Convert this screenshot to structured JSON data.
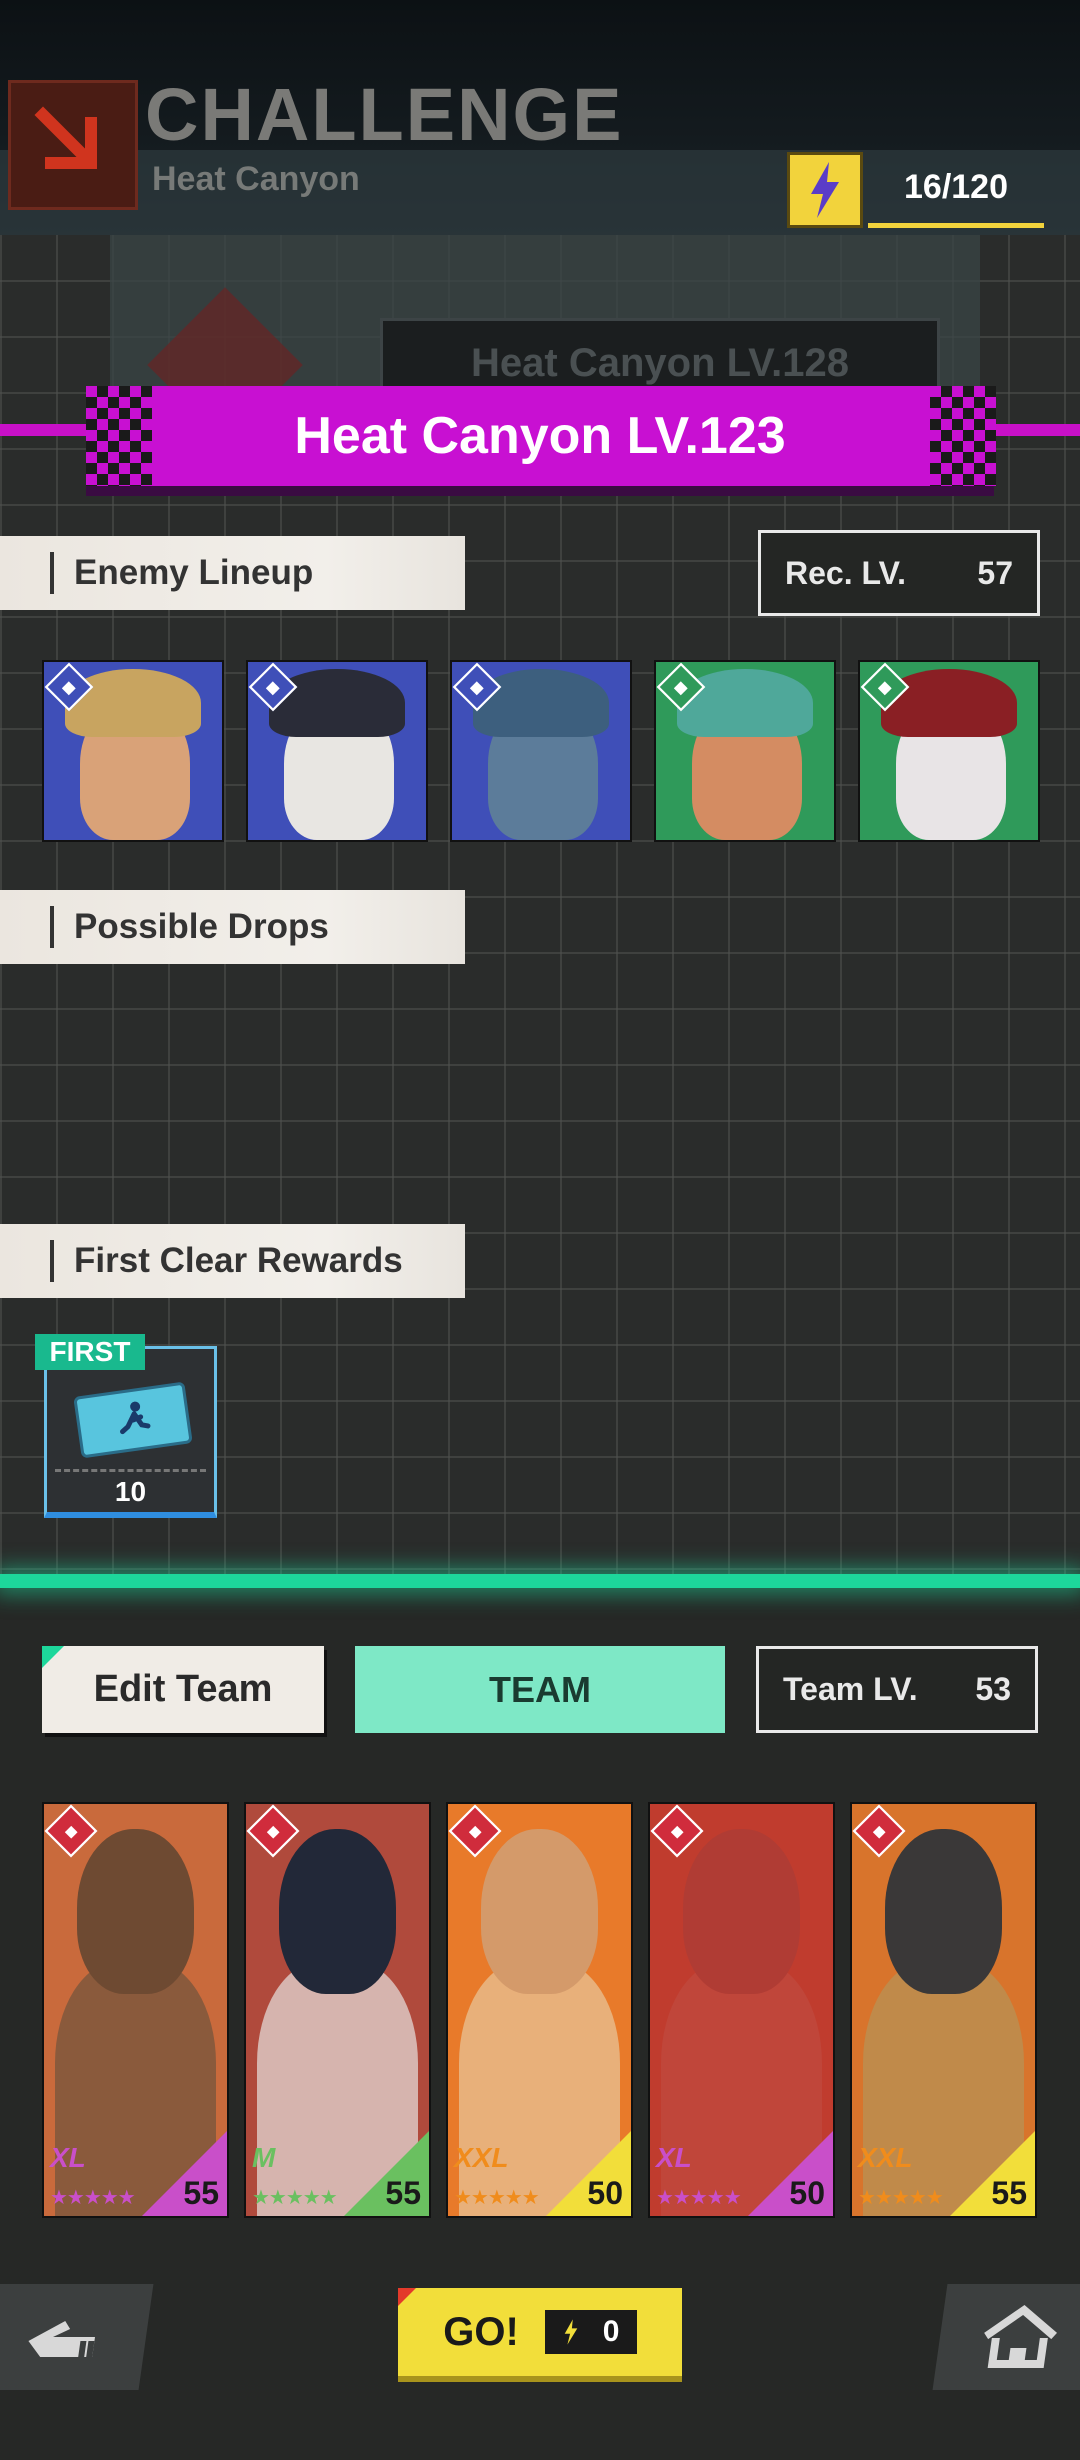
{
  "header": {
    "title": "CHALLENGE",
    "subtitle": "Heat Canyon",
    "stamina": "16/120"
  },
  "locked_level": "Heat Canyon LV.128",
  "level_banner": "Heat Canyon LV.123",
  "enemy_section": {
    "label": "Enemy Lineup",
    "rec_label": "Rec. LV.",
    "rec_value": "57"
  },
  "enemies": [
    {
      "class_icon": "plus-class-icon",
      "colors": {
        "bg": "#3f4fb8",
        "hair": "#c8a460",
        "face": "#d9a278"
      }
    },
    {
      "class_icon": "shield-class-icon",
      "colors": {
        "bg": "#3f4fb8",
        "hair": "#2a2c38",
        "face": "#e8e6e2"
      }
    },
    {
      "class_icon": "eye-class-icon",
      "colors": {
        "bg": "#3f4fb8",
        "hair": "#3d5f7e",
        "face": "#5c7c9a"
      }
    },
    {
      "class_icon": "eye-class-icon",
      "colors": {
        "bg": "#2f9a5a",
        "hair": "#4fa89a",
        "face": "#d48c62"
      }
    },
    {
      "class_icon": "shield-class-icon",
      "colors": {
        "bg": "#2f9a5a",
        "hair": "#8a1f24",
        "face": "#e8e4e6"
      }
    }
  ],
  "drops_section": {
    "label": "Possible Drops"
  },
  "rewards_section": {
    "label": "First Clear Rewards",
    "first_tag": "FIRST",
    "reward_qty": "10",
    "ticket_icon": "runner-ticket-icon"
  },
  "team": {
    "edit_label": "Edit Team",
    "team_label": "TEAM",
    "level_label": "Team LV.",
    "level_value": "53"
  },
  "members": [
    {
      "rank": "XL",
      "level": "55",
      "stars": "★★★★★",
      "colors": {
        "bg": "#c96a3c",
        "skin": "#8a5a3c",
        "head": "#6e4a32",
        "corner": "#c94fc9",
        "rank": "#c94fc9",
        "cls": "#d02c3c"
      }
    },
    {
      "rank": "M",
      "level": "55",
      "stars": "★★★★★",
      "colors": {
        "bg": "#b04a3c",
        "skin": "#d6b4ae",
        "head": "#222838",
        "corner": "#6ac060",
        "rank": "#6ac060",
        "cls": "#d02c3c"
      }
    },
    {
      "rank": "XXL",
      "level": "50",
      "stars": "★★★★★",
      "colors": {
        "bg": "#e87a2a",
        "skin": "#e8b07a",
        "head": "#d49a6a",
        "corner": "#f2de3a",
        "rank": "#f08c1c",
        "cls": "#d02c3c"
      }
    },
    {
      "rank": "XL",
      "level": "50",
      "stars": "★★★★★",
      "colors": {
        "bg": "#c03c2e",
        "skin": "#c0463a",
        "head": "#b03c34",
        "corner": "#c94fc9",
        "rank": "#c94fc9",
        "cls": "#d02c3c"
      }
    },
    {
      "rank": "XXL",
      "level": "55",
      "stars": "★★★★★",
      "colors": {
        "bg": "#d8742c",
        "skin": "#c08a4a",
        "head": "#3a3838",
        "corner": "#f2de3a",
        "rank": "#f08c1c",
        "cls": "#d02c3c"
      }
    }
  ],
  "footer": {
    "go_label": "GO!",
    "go_cost": "0"
  },
  "colors": {
    "accent_magenta": "#c810d2",
    "accent_green": "#1dd79b",
    "stamina_yellow": "#f2d33c"
  }
}
